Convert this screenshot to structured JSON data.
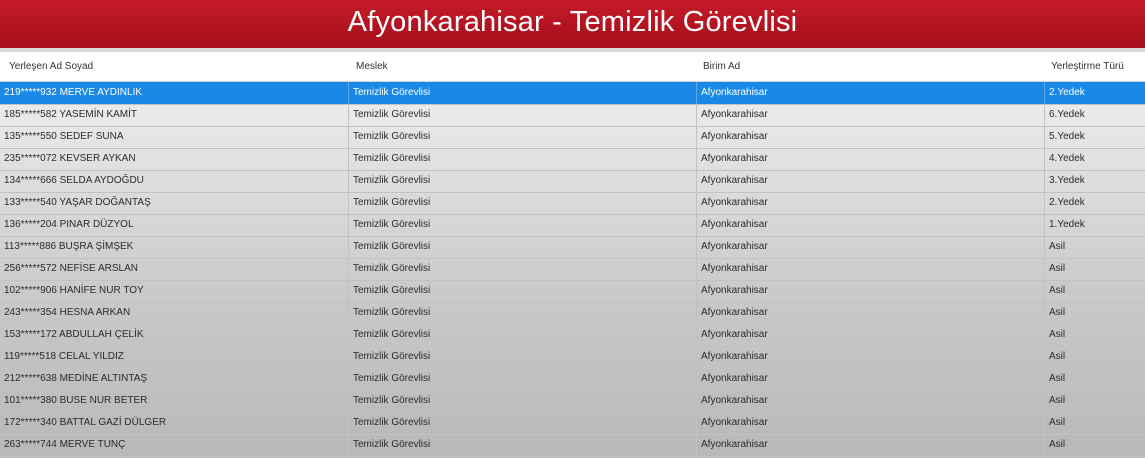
{
  "banner": {
    "title": "Afyonkarahisar - Temizlik Görevlisi"
  },
  "table": {
    "columns": [
      "Yerleşen Ad Soyad",
      "Meslek",
      "Birim Ad",
      "Yerleştirme Türü"
    ],
    "selected_row": 0,
    "rows": [
      [
        "219*****932 MERVE AYDINLIK",
        "Temizlik Görevlisi",
        "Afyonkarahisar",
        "2.Yedek"
      ],
      [
        "185*****582 YASEMİN KAMİT",
        "Temizlik Görevlisi",
        "Afyonkarahisar",
        "6.Yedek"
      ],
      [
        "135*****550 SEDEF SUNA",
        "Temizlik Görevlisi",
        "Afyonkarahisar",
        "5.Yedek"
      ],
      [
        "235*****072 KEVSER AYKAN",
        "Temizlik Görevlisi",
        "Afyonkarahisar",
        "4.Yedek"
      ],
      [
        "134*****666 SELDA AYDOĞDU",
        "Temizlik Görevlisi",
        "Afyonkarahisar",
        "3.Yedek"
      ],
      [
        "133*****540 YAŞAR DOĞANTAŞ",
        "Temizlik Görevlisi",
        "Afyonkarahisar",
        "2.Yedek"
      ],
      [
        "136*****204 PINAR DÜZYOL",
        "Temizlik Görevlisi",
        "Afyonkarahisar",
        "1.Yedek"
      ],
      [
        "113*****886 BUŞRA ŞİMŞEK",
        "Temizlik Görevlisi",
        "Afyonkarahisar",
        "Asil"
      ],
      [
        "256*****572 NEFİSE ARSLAN",
        "Temizlik Görevlisi",
        "Afyonkarahisar",
        "Asil"
      ],
      [
        "102*****906 HANİFE NUR TOY",
        "Temizlik Görevlisi",
        "Afyonkarahisar",
        "Asil"
      ],
      [
        "243*****354 HESNA ARKAN",
        "Temizlik Görevlisi",
        "Afyonkarahisar",
        "Asil"
      ],
      [
        "153*****172 ABDULLAH ÇELİK",
        "Temizlik Görevlisi",
        "Afyonkarahisar",
        "Asil"
      ],
      [
        "119*****518 CELAL YILDIZ",
        "Temizlik Görevlisi",
        "Afyonkarahisar",
        "Asil"
      ],
      [
        "212*****638 MEDİNE ALTINTAŞ",
        "Temizlik Görevlisi",
        "Afyonkarahisar",
        "Asil"
      ],
      [
        "101*****380 BUSE NUR BETER",
        "Temizlik Görevlisi",
        "Afyonkarahisar",
        "Asil"
      ],
      [
        "172*****340 BATTAL GAZİ DÜLGER",
        "Temizlik Görevlisi",
        "Afyonkarahisar",
        "Asil"
      ],
      [
        "263*****744 MERVE TUNÇ",
        "Temizlik Görevlisi",
        "Afyonkarahisar",
        "Asil"
      ]
    ]
  }
}
